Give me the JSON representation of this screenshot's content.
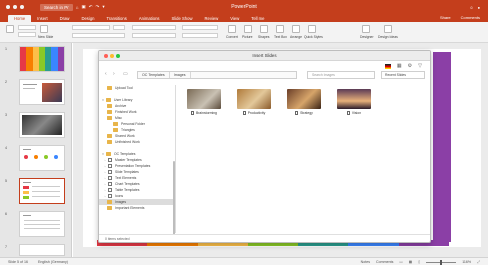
{
  "app": {
    "title": "PowerPoint",
    "quick_search_placeholder": "Search in Pr",
    "share_label": "Share",
    "comments_label": "Comments"
  },
  "ribbon": {
    "tabs": [
      "Home",
      "Insert",
      "Draw",
      "Design",
      "Transitions",
      "Animations",
      "Slide Show",
      "Review",
      "View",
      "Tell me"
    ],
    "active_tab": "Home",
    "buttons": {
      "new_slide": "New Slide",
      "arrange": "Arrange",
      "quick_styles": "Quick Styles",
      "shapes": "Shapes",
      "text_box": "Text Box",
      "convert": "Convert",
      "picture": "Picture",
      "designer": "Designer",
      "design_ideas": "Design Ideas"
    }
  },
  "thumbnails": {
    "slide_numbers": [
      "1",
      "2",
      "3",
      "4",
      "5",
      "6",
      "7"
    ],
    "selected": "5"
  },
  "dialog": {
    "title": "Insert Slides",
    "breadcrumbs": [
      "OC Templates",
      "Images"
    ],
    "search_placeholder": "Search Images",
    "view_select": "Recent Slides",
    "nav_items": [
      {
        "label": "Upload Tool",
        "kind": "folder",
        "indent": 1
      },
      {
        "label": "User Library",
        "kind": "folder",
        "indent": 0
      },
      {
        "label": "Archive",
        "kind": "folder",
        "indent": 1
      },
      {
        "label": "Finished Work",
        "kind": "folder",
        "indent": 1
      },
      {
        "label": "Misc",
        "kind": "folder",
        "indent": 1
      },
      {
        "label": "Personal Folder",
        "kind": "folder",
        "indent": 2
      },
      {
        "label": "Triangles",
        "kind": "folder",
        "indent": 2
      },
      {
        "label": "Shared Work",
        "kind": "folder",
        "indent": 1
      },
      {
        "label": "Unfinished Work",
        "kind": "folder",
        "indent": 1
      },
      {
        "label": "OC Templates",
        "kind": "folder",
        "indent": 0
      },
      {
        "label": "Master Templates",
        "kind": "template",
        "indent": 1
      },
      {
        "label": "Presentation Templates",
        "kind": "template",
        "indent": 1
      },
      {
        "label": "Slide Templates",
        "kind": "template",
        "indent": 1
      },
      {
        "label": "Text Elements",
        "kind": "template",
        "indent": 1
      },
      {
        "label": "Chart Templates",
        "kind": "template",
        "indent": 1
      },
      {
        "label": "Table Templates",
        "kind": "template",
        "indent": 1
      },
      {
        "label": "Icons",
        "kind": "template",
        "indent": 1
      },
      {
        "label": "Images",
        "kind": "folder",
        "indent": 1
      },
      {
        "label": "Important Elements",
        "kind": "folder",
        "indent": 1
      }
    ],
    "selected_nav": "Images",
    "files": [
      {
        "label": "Brainstorming",
        "color_a": "#7a6a55",
        "color_b": "#c9c1b3"
      },
      {
        "label": "Productivity",
        "color_a": "#b07a3a",
        "color_b": "#e3c89a"
      },
      {
        "label": "Strategy",
        "color_a": "#6a3e28",
        "color_b": "#d7a56a"
      },
      {
        "label": "Vision",
        "color_a": "#5a3a55",
        "color_b": "#e8b07a"
      }
    ],
    "footer": "0 items selected"
  },
  "status": {
    "left": [
      "Slide 5 of 16",
      "English (Germany)"
    ],
    "notes": "Notes",
    "comments": "Comments",
    "zoom": "116%"
  },
  "colors": {
    "accent": "#c43e1c",
    "purple": "#8b3fa6",
    "stripes": [
      "#e63946",
      "#f77f00",
      "#fcbf49",
      "#8ac926",
      "#2a9d8f",
      "#3a86ff",
      "#8b3fa6"
    ]
  }
}
